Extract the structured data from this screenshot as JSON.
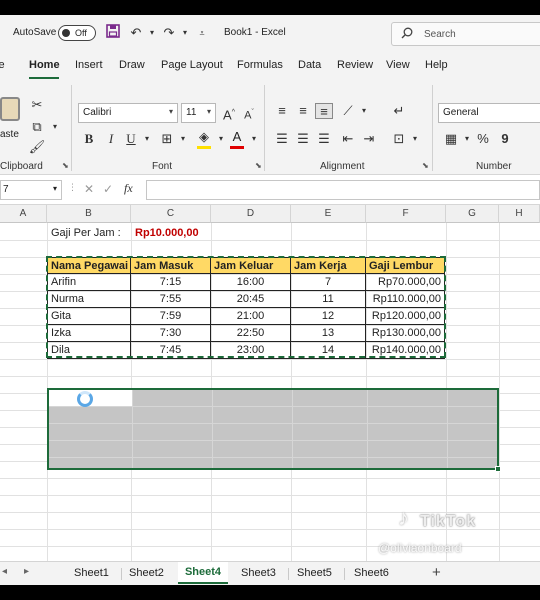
{
  "titlebar": {
    "autosave_label": "AutoSave",
    "autosave_state": "Off",
    "book_title": "Book1  -  Excel",
    "search_placeholder": "Search"
  },
  "ribbon_tabs": [
    "le",
    "Home",
    "Insert",
    "Draw",
    "Page Layout",
    "Formulas",
    "Data",
    "Review",
    "View",
    "Help"
  ],
  "active_tab": "Home",
  "ribbon": {
    "paste_label": "aste",
    "clipboard_label": "Clipboard",
    "font_name": "Calibri",
    "font_size": "11",
    "font_label": "Font",
    "alignment_label": "Alignment",
    "number_format": "General",
    "number_label": "Number",
    "font_color": "#e00000",
    "fill_color": "#ffe000"
  },
  "formula_bar": {
    "name_box": "7",
    "fx_label": "fx"
  },
  "columns": [
    "A",
    "B",
    "C",
    "D",
    "E",
    "F",
    "G",
    "H"
  ],
  "rate": {
    "label": "Gaji Per Jam :",
    "value": "Rp10.000,00"
  },
  "table": {
    "headers": [
      "Nama Pegawai",
      "Jam Masuk",
      "Jam Keluar",
      "Jam Kerja",
      "Gaji Lembur"
    ],
    "rows": [
      [
        "Arifin",
        "7:15",
        "16:00",
        "7",
        "Rp70.000,00"
      ],
      [
        "Nurma",
        "7:55",
        "20:45",
        "11",
        "Rp110.000,00"
      ],
      [
        "Gita",
        "7:59",
        "21:00",
        "12",
        "Rp120.000,00"
      ],
      [
        "Izka",
        "7:30",
        "22:50",
        "13",
        "Rp130.000,00"
      ],
      [
        "Dila",
        "7:45",
        "23:00",
        "14",
        "Rp140.000,00"
      ]
    ],
    "header_color": "#ffd965"
  },
  "watermark": {
    "brand": "TikTok",
    "handle": "@oliviaonboard"
  },
  "sheets": [
    "Sheet1",
    "Sheet2",
    "Sheet4",
    "Sheet3",
    "Sheet5",
    "Sheet6"
  ],
  "active_sheet": "Sheet4",
  "accent_color": "#1d6b3a"
}
